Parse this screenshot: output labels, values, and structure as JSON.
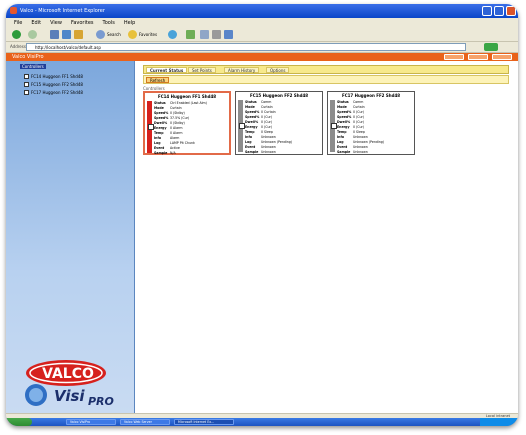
{
  "window": {
    "title": "Valco - Microsoft Internet Explorer"
  },
  "menu": [
    "File",
    "Edit",
    "View",
    "Favorites",
    "Tools",
    "Help"
  ],
  "toolbar": {
    "back_label": "Back",
    "search_label": "Search",
    "favorites_label": "Favorites"
  },
  "address": {
    "label": "Address",
    "url": "http://localhost/valco/default.asp",
    "go_label": "Go"
  },
  "app": {
    "name": "Valco VisiPro",
    "buttons": [
      "Home",
      "Options",
      "Help"
    ]
  },
  "tree": {
    "root": "Controllers",
    "items": [
      "FC14 Huggeon FF1 Shd48",
      "FC15 Huggeon FF2 Shd48",
      "FC17 Huggeon FF2 Shd48"
    ]
  },
  "tabs": [
    "Current Status",
    "Set Points",
    "Alarm History",
    "Options"
  ],
  "action": {
    "label": "Refresh"
  },
  "caption": "Controllers",
  "panels": [
    {
      "title": "FC14 Huggeon FF1 Shd48",
      "selected": true,
      "bar_color": "#d6211d",
      "rows": [
        {
          "k": "Status",
          "v": "Ctrl Enabled (Last Alm)"
        },
        {
          "k": "Mode",
          "v": "Curtain"
        },
        {
          "k": "Speed%",
          "v": "0 (Stdby)"
        },
        {
          "k": "Speed%",
          "v": "37.5% (Cur)"
        },
        {
          "k": "Dwell%",
          "v": "0 (Stdby)"
        },
        {
          "k": "Energy",
          "v": "0 Alarm"
        },
        {
          "k": "Temp",
          "v": "0 Alarm"
        },
        {
          "k": "Info",
          "v": "Alarm"
        },
        {
          "k": "Log",
          "v": "LAMP Pit Chunk"
        },
        {
          "k": "Event",
          "v": "Active"
        },
        {
          "k": "Sample",
          "v": "N/A"
        }
      ]
    },
    {
      "title": "FC15 Huggeon FF2 Shd48",
      "selected": false,
      "bar_color": "#8c8c8c",
      "rows": [
        {
          "k": "Status",
          "v": "Comm"
        },
        {
          "k": "Mode",
          "v": "Curtain"
        },
        {
          "k": "Speed%",
          "v": "0 Curtain"
        },
        {
          "k": "Speed%",
          "v": "0 (Cur)"
        },
        {
          "k": "Dwell%",
          "v": "0 (Cur)"
        },
        {
          "k": "Energy",
          "v": "0 (Cur)"
        },
        {
          "k": "Temp",
          "v": "0 Sleep"
        },
        {
          "k": "Info",
          "v": "Unknown"
        },
        {
          "k": "Log",
          "v": "Unknown (Pending)"
        },
        {
          "k": "Event",
          "v": "Unknown"
        },
        {
          "k": "Sample",
          "v": "Unknown"
        }
      ]
    },
    {
      "title": "FC17 Huggeon FF2 Shd48",
      "selected": false,
      "bar_color": "#8c8c8c",
      "rows": [
        {
          "k": "Status",
          "v": "Comm"
        },
        {
          "k": "Mode",
          "v": "Curtain"
        },
        {
          "k": "Speed%",
          "v": "0 (Cur)"
        },
        {
          "k": "Speed%",
          "v": "0 (Cur)"
        },
        {
          "k": "Dwell%",
          "v": "0 (Cur)"
        },
        {
          "k": "Energy",
          "v": "0 (Cur)"
        },
        {
          "k": "Temp",
          "v": "0 Sleep"
        },
        {
          "k": "Info",
          "v": "Unknown"
        },
        {
          "k": "Log",
          "v": "Unknown (Pending)"
        },
        {
          "k": "Event",
          "v": "Unknown"
        },
        {
          "k": "Sample",
          "v": "Unknown"
        }
      ]
    }
  ],
  "logo": {
    "brand": "VALCO",
    "product": "Visi",
    "product_suffix": "PRO"
  },
  "status": {
    "zone": "Local intranet"
  },
  "taskbar": {
    "start_label": "start",
    "tasks": [
      "Valco VisiPro",
      "Valco Web Server",
      "Microsoft Internet Ex..."
    ]
  },
  "colors": {
    "accent": "#e9621a",
    "sidebar": "#9cbce6",
    "selected_border": "#e26a48"
  }
}
